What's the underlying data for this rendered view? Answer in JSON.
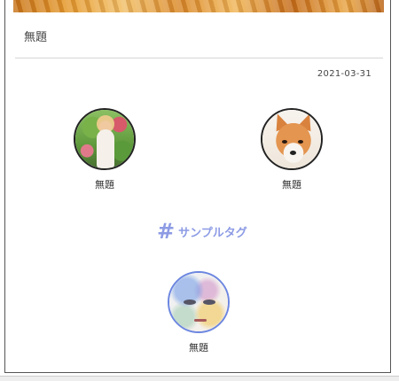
{
  "post": {
    "title": "無題",
    "date": "2021-03-31"
  },
  "thumbnails": [
    {
      "label": "無題",
      "image": "girl-in-garden-painting"
    },
    {
      "label": "無題",
      "image": "fox-portrait"
    },
    {
      "label": "無題",
      "image": "watercolor-face"
    }
  ],
  "tag": {
    "hash": "#",
    "label": "サンプルタグ",
    "color": "#8c9be4"
  }
}
